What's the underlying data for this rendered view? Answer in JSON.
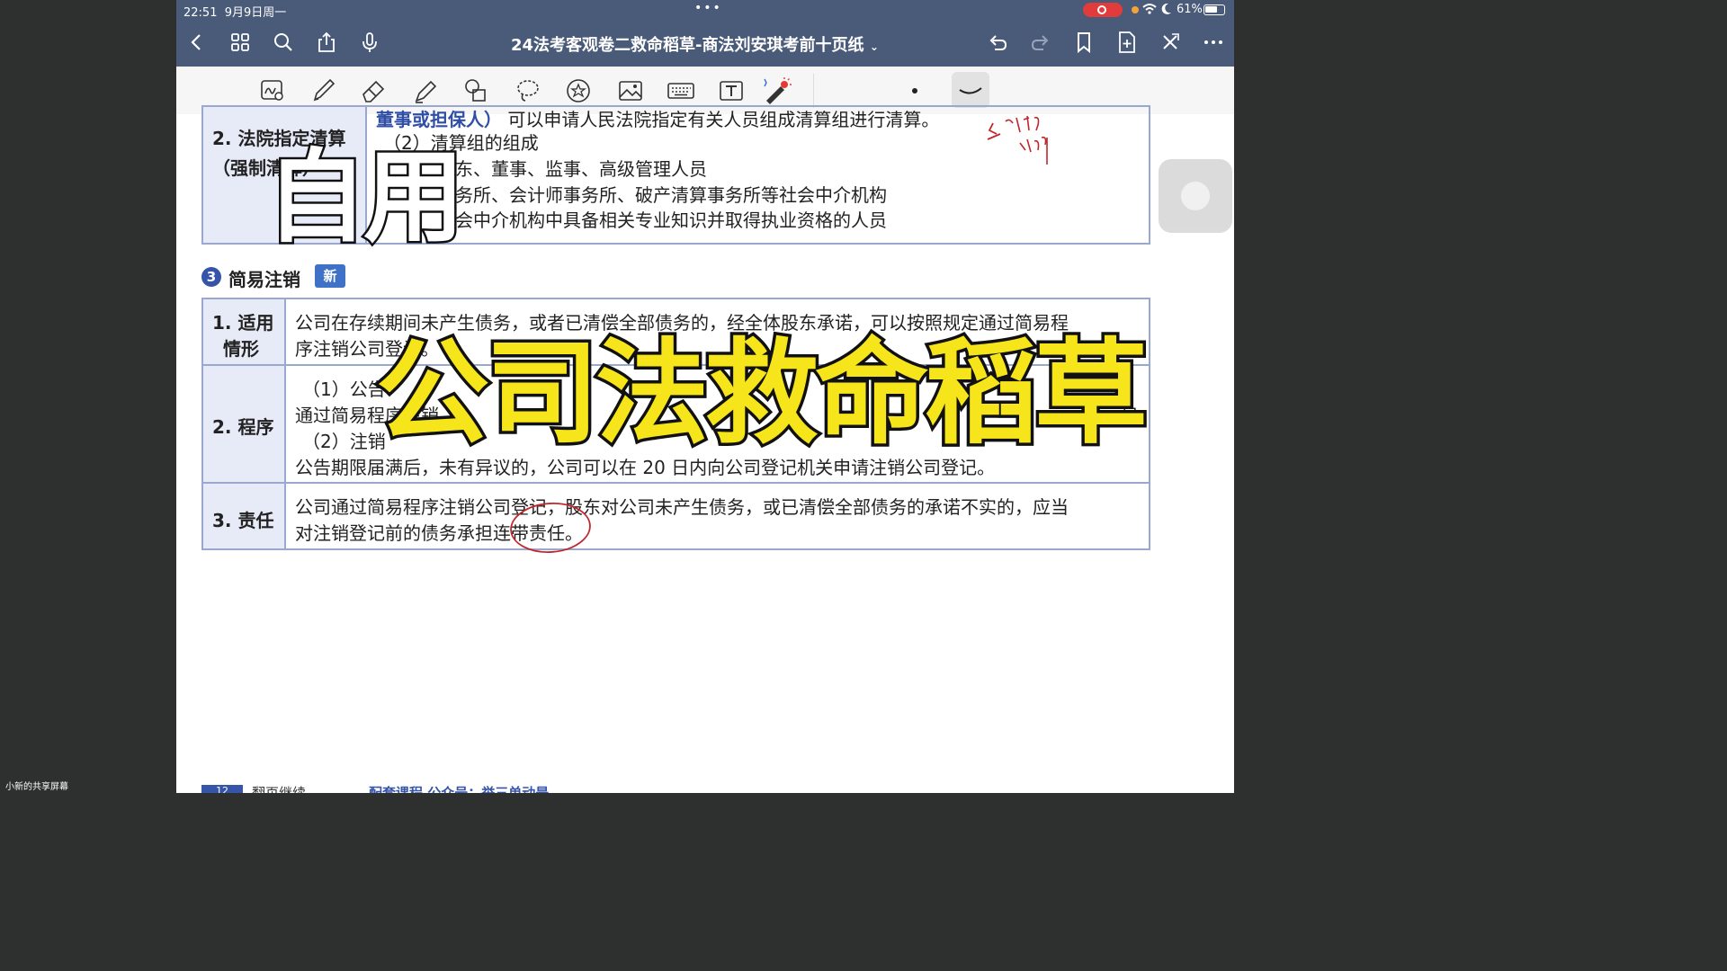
{
  "status_bar": {
    "time": "22:51",
    "date": "9月9日周一",
    "dots": "•••",
    "battery": "61%"
  },
  "nav": {
    "title": "24法考客观卷二救命稻草-商法刘安琪考前十页纸"
  },
  "doc": {
    "table1": {
      "label_line1": "2. 法院指定清算",
      "label_line2": "（强制清算）",
      "line1_bold": "董事或担保人）",
      "line1_rest": "可以申请人民法院指定有关人员组成清算组进行清算。",
      "line2": "（2）清算组的组成",
      "line3": "东、董事、监事、高级管理人员",
      "line4": "务所、会计师事务所、破产清算事务所等社会中介机构",
      "line5": "会中介机构中具备相关专业知识并取得执业资格的人员"
    },
    "section3": {
      "num": "3",
      "title": "简易注销",
      "badge": "新"
    },
    "table2": {
      "rows": [
        {
          "label1": "1. 适用",
          "label2": "情形",
          "lines": [
            "公司在存续期间未产生债务，或者已清偿全部债务的，经全体股东承诺，可以按照规定通过简易程",
            "序注销公司登记。"
          ]
        },
        {
          "label1": "2. 程序",
          "label2": "",
          "lines": [
            "（1）公告",
            "通过简易程序注销",
            "日。",
            "（2）注销",
            "公告期限届满后，未有异议的，公司可以在 20 日内向公司登记机关申请注销公司登记。"
          ]
        },
        {
          "label1": "3. 责任",
          "label2": "",
          "lines": [
            "公司通过简易程序注销公司登记，股东对公司未产生债务，或已清偿全部债务的承诺不实的，应当",
            "对注销登记前的债务承担连带责任。"
          ]
        }
      ]
    },
    "footer": {
      "page": "12",
      "turn": "翻页继续",
      "link": "配套课程 公众号：举三单动是"
    }
  },
  "overlay": {
    "small_text": "自用",
    "main_text": "公司法救命稻草"
  },
  "share_label": "小新的共享屏幕",
  "colors": {
    "nav_bg": "#4a5a79",
    "table_border": "#9aa7cf",
    "label_bg": "#e6ebf7",
    "highlight_yellow": "#f6e51a",
    "accent_blue": "#3655a8"
  }
}
